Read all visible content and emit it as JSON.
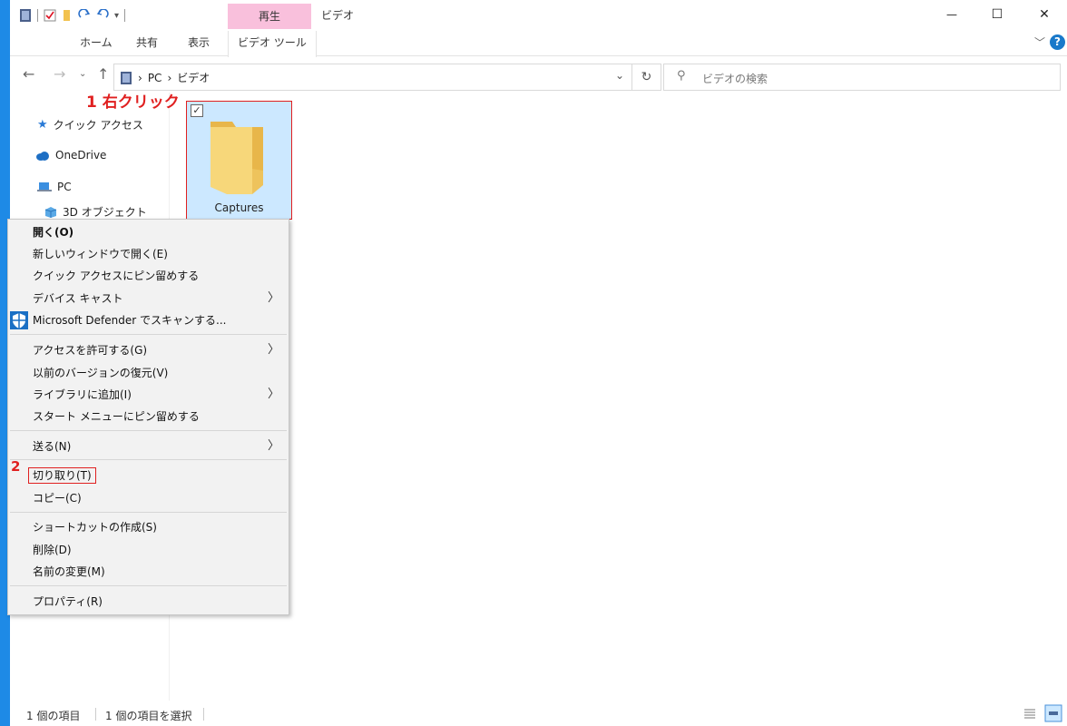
{
  "window": {
    "title": "ビデオ",
    "context_tab": "再生",
    "controls": {
      "minimize": "—",
      "maximize": "☐",
      "close": "✕"
    }
  },
  "ribbon": {
    "tabs": [
      {
        "label": "ホーム"
      },
      {
        "label": "共有"
      },
      {
        "label": "表示"
      },
      {
        "label": "ビデオ ツール"
      }
    ],
    "help": "?"
  },
  "address_bar": {
    "crumbs": [
      "PC",
      "ビデオ"
    ],
    "search_placeholder": "ビデオの検索"
  },
  "nav_pane": {
    "items": [
      {
        "label": "クイック アクセス",
        "icon": "star-icon"
      },
      {
        "label": "OneDrive",
        "icon": "cloud-icon"
      },
      {
        "label": "PC",
        "icon": "computer-icon"
      },
      {
        "label": "3D オブジェクト",
        "icon": "cube-icon"
      }
    ]
  },
  "content": {
    "folders": [
      {
        "name": "Captures",
        "selected": true
      }
    ]
  },
  "annotations": {
    "step1": "1 右クリック",
    "step2": "2"
  },
  "context_menu": {
    "items": [
      {
        "label": "開く(O)",
        "bold": true
      },
      {
        "label": "新しいウィンドウで開く(E)"
      },
      {
        "label": "クイック アクセスにピン留めする"
      },
      {
        "label": "デバイス キャスト",
        "submenu": true
      },
      {
        "label": "Microsoft Defender でスキャンする...",
        "icon": "shield-icon"
      },
      {
        "label": "アクセスを許可する(G)",
        "submenu": true
      },
      {
        "label": "以前のバージョンの復元(V)"
      },
      {
        "label": "ライブラリに追加(I)",
        "submenu": true
      },
      {
        "label": "スタート メニューにピン留めする"
      },
      {
        "label": "送る(N)",
        "submenu": true
      },
      {
        "label": "切り取り(T)",
        "highlighted": true
      },
      {
        "label": "コピー(C)"
      },
      {
        "label": "ショートカットの作成(S)"
      },
      {
        "label": "削除(D)"
      },
      {
        "label": "名前の変更(M)"
      },
      {
        "label": "プロパティ(R)"
      }
    ]
  },
  "status_bar": {
    "item_count": "1 個の項目",
    "selected_count": "1 個の項目を選択"
  },
  "colors": {
    "accent": "#1e8ae6",
    "annotation": "#e02020",
    "selection": "#cce8ff",
    "context_tab": "#f9c0dc"
  }
}
